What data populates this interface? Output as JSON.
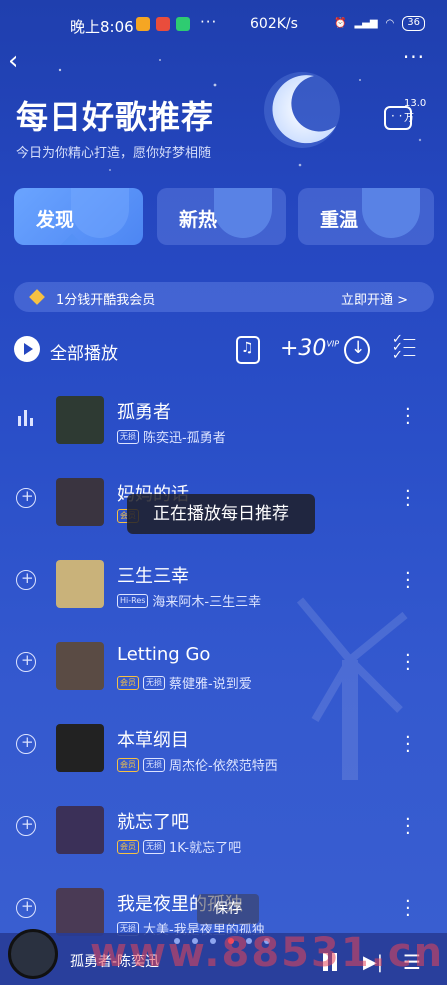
{
  "status": {
    "time": "晚上8:06",
    "dots": "···",
    "speed": "602K/s",
    "battery": "36"
  },
  "header": {
    "title": "每日好歌推荐",
    "subtitle": "今日为你精心打造，愿你好梦相随",
    "comment_count": "13.0万"
  },
  "tabs": [
    {
      "label": "发现"
    },
    {
      "label": "新热"
    },
    {
      "label": "重温"
    }
  ],
  "vip": {
    "text": "1分钱开酷我会员",
    "action": "立即开通 >"
  },
  "toolbar": {
    "play_all": "全部播放",
    "plus30": "+30",
    "vip_sup": "VIP"
  },
  "songs": [
    {
      "name": "孤勇者",
      "tags": [
        "无损"
      ],
      "artist_album": "陈奕迅-孤勇者",
      "cover": "#2e3a33",
      "playing": true
    },
    {
      "name": "妈妈的话",
      "tags": [
        "会员"
      ],
      "artist_album": "",
      "cover": "#3a3440",
      "playing": false
    },
    {
      "name": "三生三幸",
      "tags": [
        "Hi-Res"
      ],
      "artist_album": "海来阿木-三生三幸",
      "cover": "#c9b27a",
      "playing": false
    },
    {
      "name": "Letting Go",
      "tags": [
        "会员",
        "无损"
      ],
      "artist_album": "蔡健雅-说到爱",
      "cover": "#5a4b44",
      "playing": false
    },
    {
      "name": "本草纲目",
      "tags": [
        "会员",
        "无损"
      ],
      "artist_album": "周杰伦-依然范特西",
      "cover": "#222222",
      "playing": false
    },
    {
      "name": "就忘了吧",
      "tags": [
        "会员",
        "无损"
      ],
      "artist_album": "1K-就忘了吧",
      "cover": "#3b3058",
      "playing": false
    },
    {
      "name": "我是夜里的孤独",
      "tags": [
        "无损"
      ],
      "artist_album": "大美-我是夜里的孤独",
      "cover": "#4a3a55",
      "playing": false
    }
  ],
  "toast": "正在播放每日推荐",
  "save_label": "保存",
  "player": {
    "now_playing": "孤勇者-陈奕迅"
  },
  "watermark": "www.88531.cn"
}
